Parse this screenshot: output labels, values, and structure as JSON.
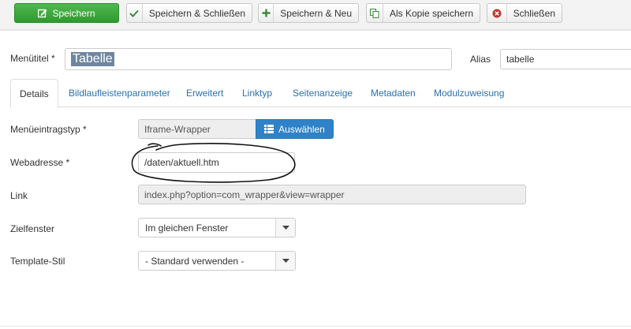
{
  "toolbar": {
    "save": "Speichern",
    "save_close": "Speichern & Schließen",
    "save_new": "Speichern & Neu",
    "save_copy": "Als Kopie speichern",
    "close": "Schließen"
  },
  "title_field": {
    "label": "Menütitel *",
    "value": "Tabelle"
  },
  "alias_field": {
    "label": "Alias",
    "value": "tabelle"
  },
  "tabs": [
    {
      "label": "Details",
      "active": true
    },
    {
      "label": "Bildlaufleistenparameter"
    },
    {
      "label": "Erweitert"
    },
    {
      "label": "Linktyp"
    },
    {
      "label": "Seitenanzeige"
    },
    {
      "label": "Metadaten"
    },
    {
      "label": "Modulzuweisung"
    }
  ],
  "form": {
    "type": {
      "label": "Menüeintragstyp *",
      "value": "Iframe-Wrapper",
      "button": "Auswählen"
    },
    "url": {
      "label": "Webadresse *",
      "value": "/daten/aktuell.htm"
    },
    "link": {
      "label": "Link",
      "value": "index.php?option=com_wrapper&view=wrapper"
    },
    "target": {
      "label": "Zielfenster",
      "value": "Im gleichen Fenster"
    },
    "template": {
      "label": "Template-Stil",
      "value": "- Standard verwenden -"
    }
  },
  "colors": {
    "save_green": "#3aa63a",
    "primary_blue": "#2f82c8",
    "link_blue": "#2a6fb0"
  }
}
